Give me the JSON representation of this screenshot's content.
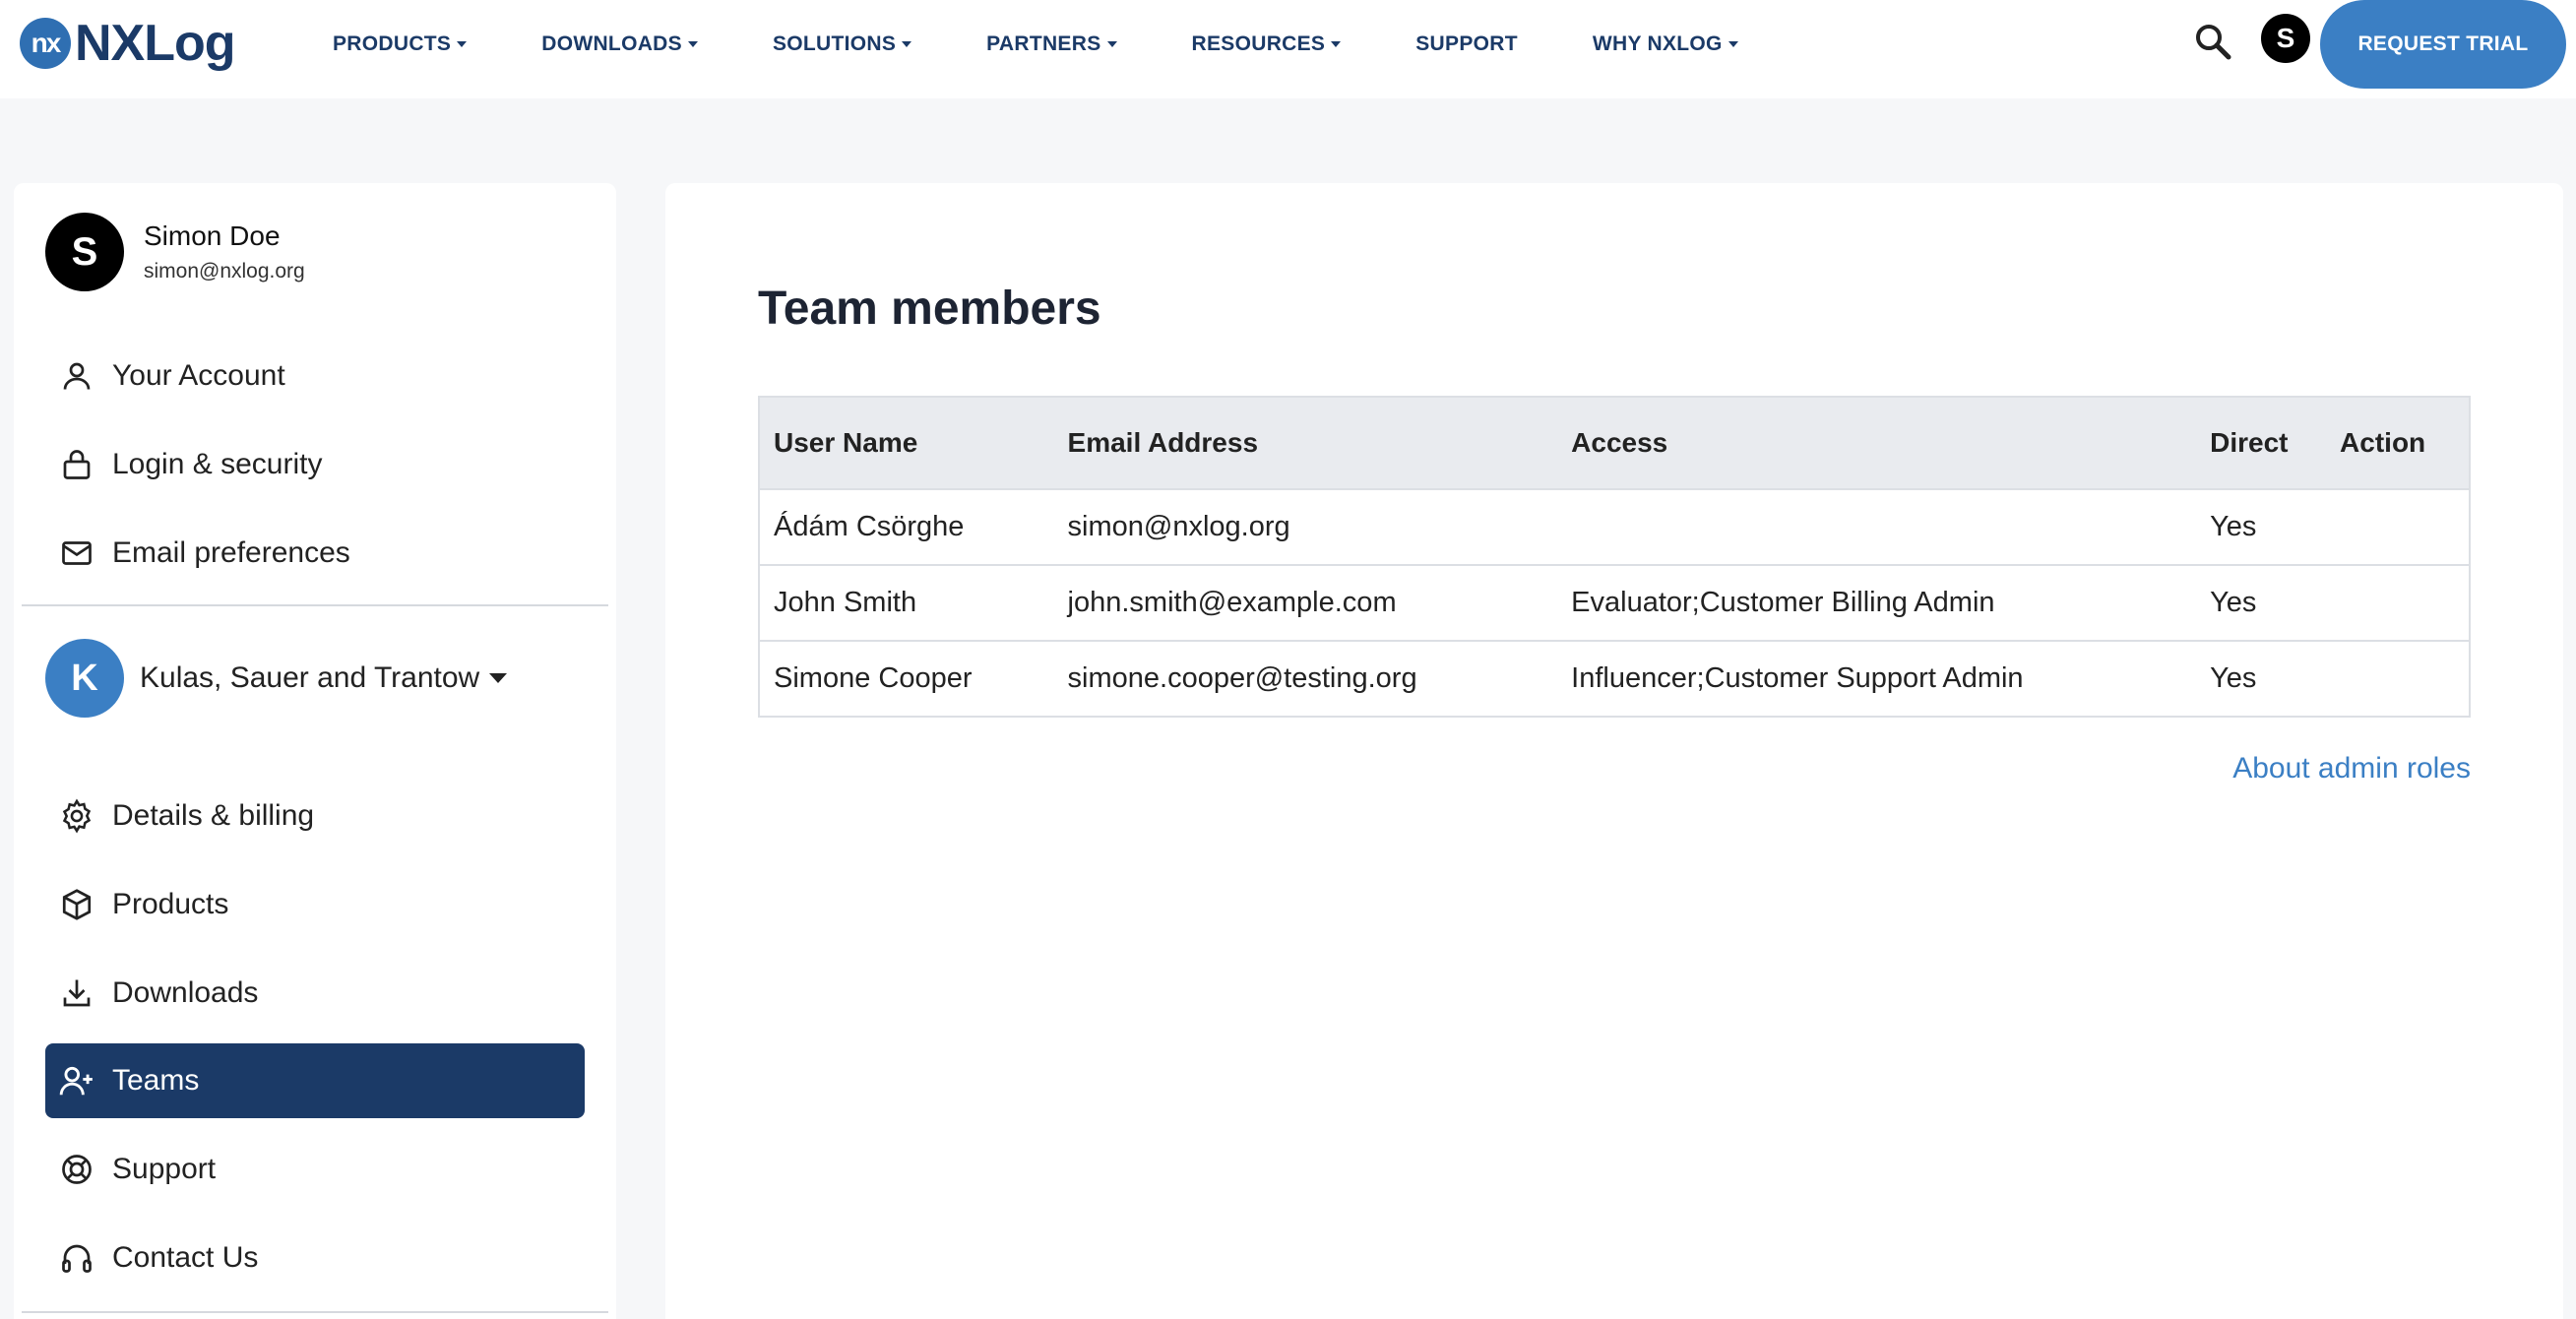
{
  "header": {
    "logo_mark": "nx",
    "logo_text": "NXLog",
    "nav": [
      {
        "label": "PRODUCTS"
      },
      {
        "label": "DOWNLOADS"
      },
      {
        "label": "SOLUTIONS"
      },
      {
        "label": "PARTNERS"
      },
      {
        "label": "RESOURCES"
      },
      {
        "label": "SUPPORT"
      },
      {
        "label": "WHY NXLOG"
      }
    ],
    "avatar_initial": "S",
    "trial_button": "REQUEST TRIAL"
  },
  "sidebar": {
    "user": {
      "initial": "S",
      "name": "Simon Doe",
      "email": "simon@nxlog.org"
    },
    "account_items": [
      {
        "label": "Your Account",
        "icon": "user-icon"
      },
      {
        "label": "Login & security",
        "icon": "lock-icon"
      },
      {
        "label": "Email preferences",
        "icon": "mail-icon"
      }
    ],
    "org": {
      "initial": "K",
      "name": "Kulas, Sauer and Trantow"
    },
    "org_items": [
      {
        "label": "Details & billing",
        "icon": "gear-icon"
      },
      {
        "label": "Products",
        "icon": "box-icon"
      },
      {
        "label": "Downloads",
        "icon": "download-icon"
      },
      {
        "label": "Teams",
        "icon": "user-plus-icon",
        "active": true
      },
      {
        "label": "Support",
        "icon": "lifebuoy-icon"
      },
      {
        "label": "Contact Us",
        "icon": "headset-icon"
      }
    ]
  },
  "main": {
    "title": "Team members",
    "table": {
      "headers": [
        "User Name",
        "Email Address",
        "Access",
        "Direct",
        "Action"
      ],
      "rows": [
        [
          "Ádám Csörghe",
          "simon@nxlog.org",
          "",
          "Yes",
          ""
        ],
        [
          "John Smith",
          "john.smith@example.com",
          "Evaluator;Customer Billing Admin",
          "Yes",
          ""
        ],
        [
          "Simone Cooper",
          "simone.cooper@testing.org",
          "Influencer;Customer Support Admin",
          "Yes",
          ""
        ]
      ]
    },
    "roles_link": "About admin roles"
  },
  "colors": {
    "brand_dark": "#1b3a67",
    "brand_blue": "#3b7fc4"
  }
}
